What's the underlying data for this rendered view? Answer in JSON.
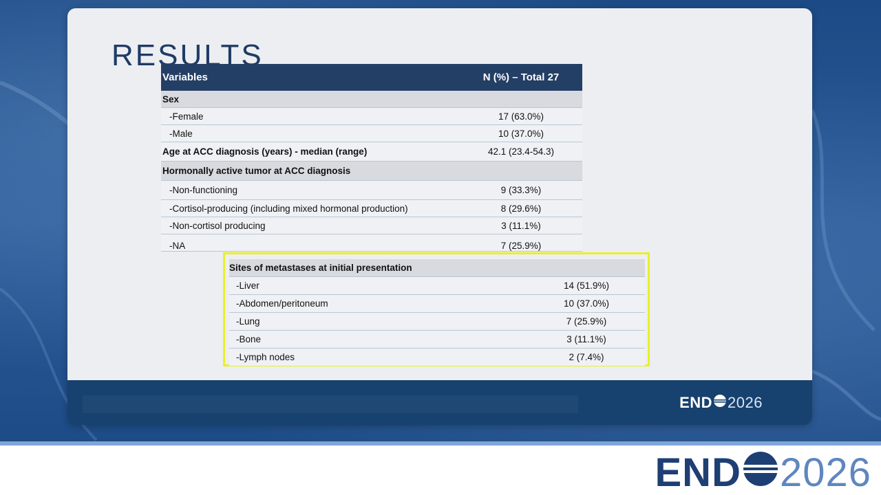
{
  "slide": {
    "title": "RESULTS"
  },
  "table": {
    "headers": [
      "Variables",
      "N (%) – Total 27"
    ],
    "rows": [
      {
        "label": "Sex",
        "value": "",
        "group": true
      },
      {
        "label": "-Female",
        "value": "17 (63.0%)"
      },
      {
        "label": "-Male",
        "value": "10 (37.0%)"
      },
      {
        "label": "Age at ACC diagnosis (years) - median (range)",
        "value": "42.1 (23.4-54.3)",
        "bold": true
      },
      {
        "label": "Hormonally active tumor at ACC diagnosis",
        "value": "",
        "group": true
      },
      {
        "label": "-Non-functioning",
        "value": "9 (33.3%)"
      },
      {
        "label": "-Cortisol-producing (including mixed hormonal production)",
        "value": "8 (29.6%)"
      },
      {
        "label": "-Non-cortisol producing",
        "value": "3 (11.1%)"
      },
      {
        "label": "-NA",
        "value": "7 (25.9%)"
      }
    ],
    "highlighted": [
      {
        "label": "Sites of metastases at initial presentation",
        "value": "",
        "group": true
      },
      {
        "label": "-Liver",
        "value": "14 (51.9%)"
      },
      {
        "label": "-Abdomen/peritoneum",
        "value": "10 (37.0%)"
      },
      {
        "label": "-Lung",
        "value": "7 (25.9%)"
      },
      {
        "label": "-Bone",
        "value": "3 (11.1%)"
      },
      {
        "label": "-Lymph nodes",
        "value": "2 (7.4%)"
      }
    ]
  },
  "logo": {
    "bold": "END",
    "year": "2026"
  },
  "colors": {
    "header_bg": "#243f66",
    "highlight_border": "#e8f02a",
    "brand_dark": "#1e3f73",
    "brand_light": "#5f86bf"
  }
}
